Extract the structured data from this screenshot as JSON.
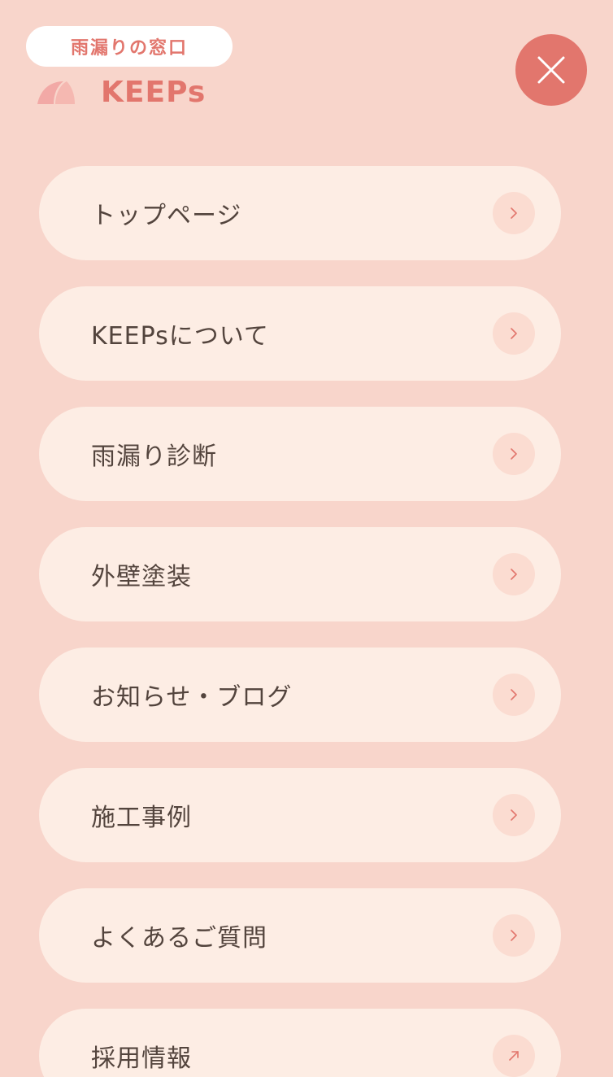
{
  "header": {
    "tagline": "雨漏りの窓口",
    "brand": "KEEPs",
    "close_icon": "close-icon"
  },
  "menu": {
    "items": [
      {
        "label": "トップページ",
        "icon": "chevron-right-icon"
      },
      {
        "label": "KEEPsについて",
        "icon": "chevron-right-icon"
      },
      {
        "label": "雨漏り診断",
        "icon": "chevron-right-icon"
      },
      {
        "label": "外壁塗装",
        "icon": "chevron-right-icon"
      },
      {
        "label": "お知らせ・ブログ",
        "icon": "chevron-right-icon"
      },
      {
        "label": "施工事例",
        "icon": "chevron-right-icon"
      },
      {
        "label": "よくあるご質問",
        "icon": "chevron-right-icon"
      },
      {
        "label": "採用情報",
        "icon": "external-link-arrow-icon"
      }
    ]
  },
  "colors": {
    "background": "#f8d5cb",
    "accent": "#e2766d",
    "item_background": "#fdede4",
    "arrow_circle": "#fbdcd1",
    "text": "#53443d"
  }
}
